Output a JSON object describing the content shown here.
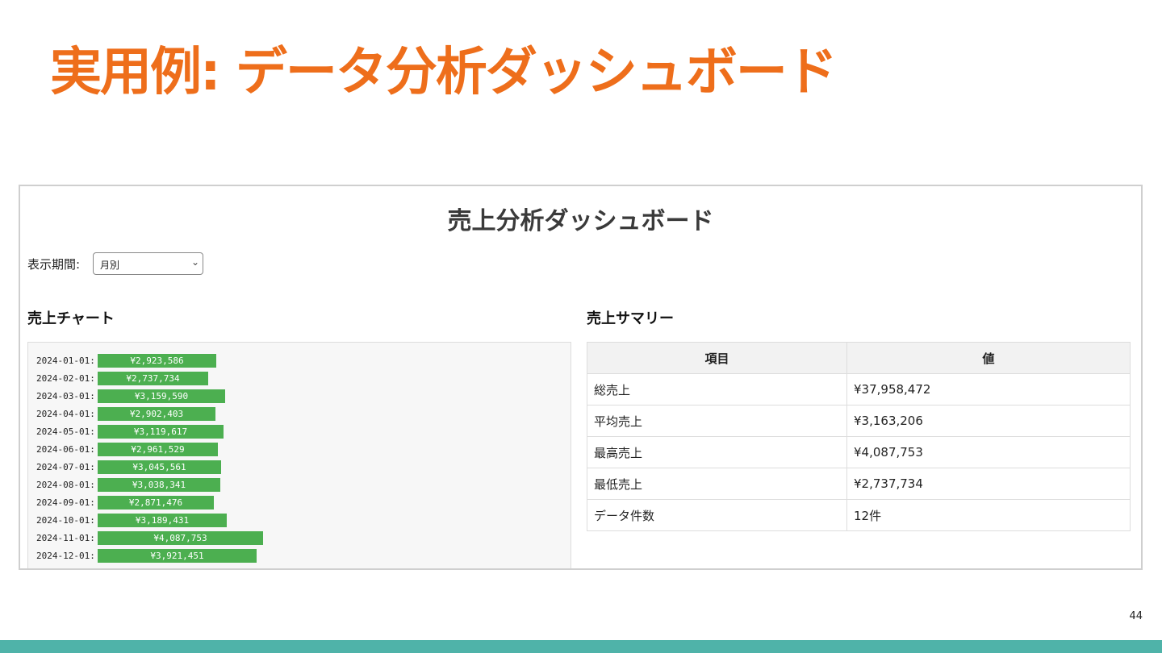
{
  "slide": {
    "title": "実用例: データ分析ダッシュボード",
    "title_color": "#ee6e1b",
    "page_number": "44",
    "footer_band_color": "#4fb3a9"
  },
  "dashboard": {
    "title": "売上分析ダッシュボード",
    "period_label": "表示期間:",
    "period_value": "月別",
    "chart_heading": "売上チャート",
    "summary_heading": "売上サマリー",
    "bar_color": "#4caf50"
  },
  "chart_data": {
    "type": "bar",
    "orientation": "horizontal",
    "categories": [
      "2024-01-01:",
      "2024-02-01:",
      "2024-03-01:",
      "2024-04-01:",
      "2024-05-01:",
      "2024-06-01:",
      "2024-07-01:",
      "2024-08-01:",
      "2024-09-01:",
      "2024-10-01:",
      "2024-11-01:",
      "2024-12-01:"
    ],
    "values": [
      2923586,
      2737734,
      3159590,
      2902403,
      3119617,
      2961529,
      3045561,
      3038341,
      2871476,
      3189431,
      4087753,
      3921451
    ],
    "labels": [
      "¥2,923,586",
      "¥2,737,734",
      "¥3,159,590",
      "¥2,902,403",
      "¥3,119,617",
      "¥2,961,529",
      "¥3,045,561",
      "¥3,038,341",
      "¥2,871,476",
      "¥3,189,431",
      "¥4,087,753",
      "¥3,921,451"
    ]
  },
  "summary": {
    "headers": [
      "項目",
      "値"
    ],
    "rows": [
      [
        "総売上",
        "¥37,958,472"
      ],
      [
        "平均売上",
        "¥3,163,206"
      ],
      [
        "最高売上",
        "¥4,087,753"
      ],
      [
        "最低売上",
        "¥2,737,734"
      ],
      [
        "データ件数",
        "12件"
      ]
    ]
  }
}
